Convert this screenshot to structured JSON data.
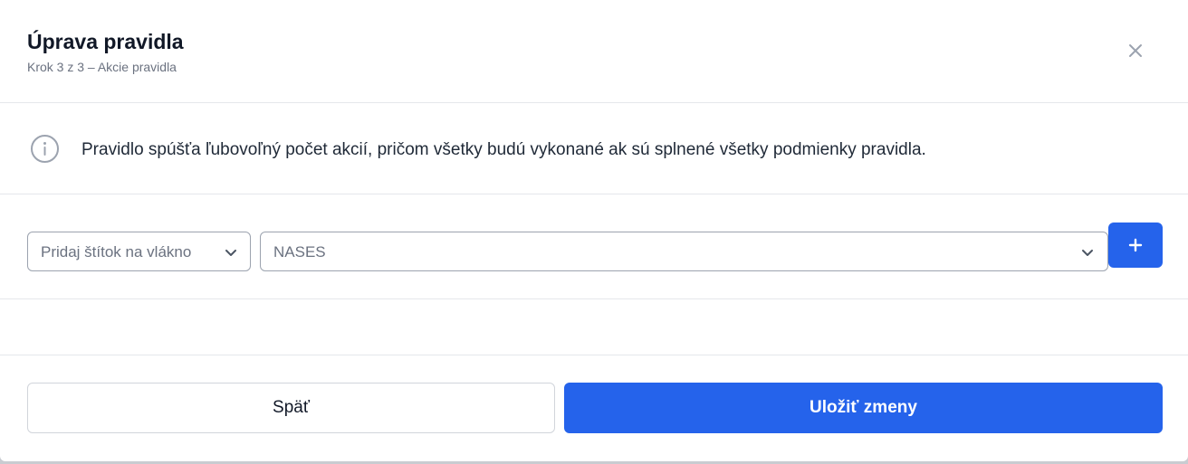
{
  "dialog": {
    "title": "Úprava pravidla",
    "subtitle": "Krok 3 z 3 – Akcie pravidla",
    "close_icon": "close-icon"
  },
  "info": {
    "icon": "info-icon",
    "text": "Pravidlo spúšťa ľubovoľný počet akcií, pričom všetky budú vykonané ak sú splnené všetky podmienky pravidla."
  },
  "action": {
    "type_select": "Pridaj štítok na vlákno",
    "value_select": "NASES",
    "add_icon": "plus-icon"
  },
  "footer": {
    "back_label": "Späť",
    "save_label": "Uložiť zmeny"
  },
  "colors": {
    "accent": "#2563eb",
    "text": "#111827",
    "muted": "#6b7280",
    "border": "#e5e7eb"
  }
}
